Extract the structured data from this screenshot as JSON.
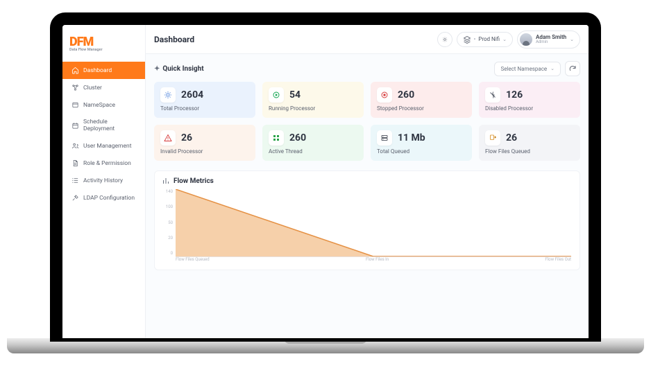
{
  "brand": {
    "name": "DFM",
    "tagline": "Data Flow Manager"
  },
  "sidebar": {
    "items": [
      {
        "label": "Dashboard",
        "icon": "home-icon",
        "active": true
      },
      {
        "label": "Cluster",
        "icon": "cluster-icon"
      },
      {
        "label": "NameSpace",
        "icon": "namespace-icon"
      },
      {
        "label": "Schedule Deployment",
        "icon": "calendar-icon"
      },
      {
        "label": "User Management",
        "icon": "users-icon"
      },
      {
        "label": "Role & Permission",
        "icon": "document-icon"
      },
      {
        "label": "Activity History",
        "icon": "list-icon"
      },
      {
        "label": "LDAP Configuration",
        "icon": "tools-icon"
      }
    ]
  },
  "header": {
    "title": "Dashboard",
    "env_label": "Prod Nifi",
    "user": {
      "name": "Adam Smith",
      "role": "Admin"
    }
  },
  "insight": {
    "title": "Quick Insight",
    "namespace_placeholder": "Select Namespace",
    "cards": [
      {
        "value": "2604",
        "label": "Total Processor",
        "tone": "c-blue",
        "icon": "processor-icon",
        "icon_color": "#2f6fd6"
      },
      {
        "value": "54",
        "label": "Running Processor",
        "tone": "c-yellow",
        "icon": "running-icon",
        "icon_color": "#0aa34a"
      },
      {
        "value": "260",
        "label": "Stopped Processor",
        "tone": "c-red",
        "icon": "stopped-icon",
        "icon_color": "#d63a3a"
      },
      {
        "value": "126",
        "label": "Disabled Processor",
        "tone": "c-pink",
        "icon": "disabled-icon",
        "icon_color": "#5b616e"
      },
      {
        "value": "26",
        "label": "Invalid Processor",
        "tone": "c-orange",
        "icon": "warning-icon",
        "icon_color": "#d63a3a"
      },
      {
        "value": "260",
        "label": "Active Thread",
        "tone": "c-green",
        "icon": "grid-icon",
        "icon_color": "#2aa34a"
      },
      {
        "value": "11 Mb",
        "label": "Total Queued",
        "tone": "c-cyan",
        "icon": "storage-icon",
        "icon_color": "#2d3340"
      },
      {
        "value": "26",
        "label": "Flow Files Queued",
        "tone": "c-grey",
        "icon": "file-flow-icon",
        "icon_color": "#d68a1a"
      }
    ]
  },
  "metrics": {
    "title": "Flow Metrics"
  },
  "chart_data": {
    "type": "area",
    "x": [
      "Flow Files Queued",
      "Flow Files In",
      "Flow Files Out"
    ],
    "values": [
      150,
      1,
      1
    ],
    "y_ticks": [
      0,
      20,
      50,
      100,
      140
    ],
    "ylim": [
      0,
      150
    ],
    "fill": "#f5c89b",
    "stroke": "#e59144"
  }
}
